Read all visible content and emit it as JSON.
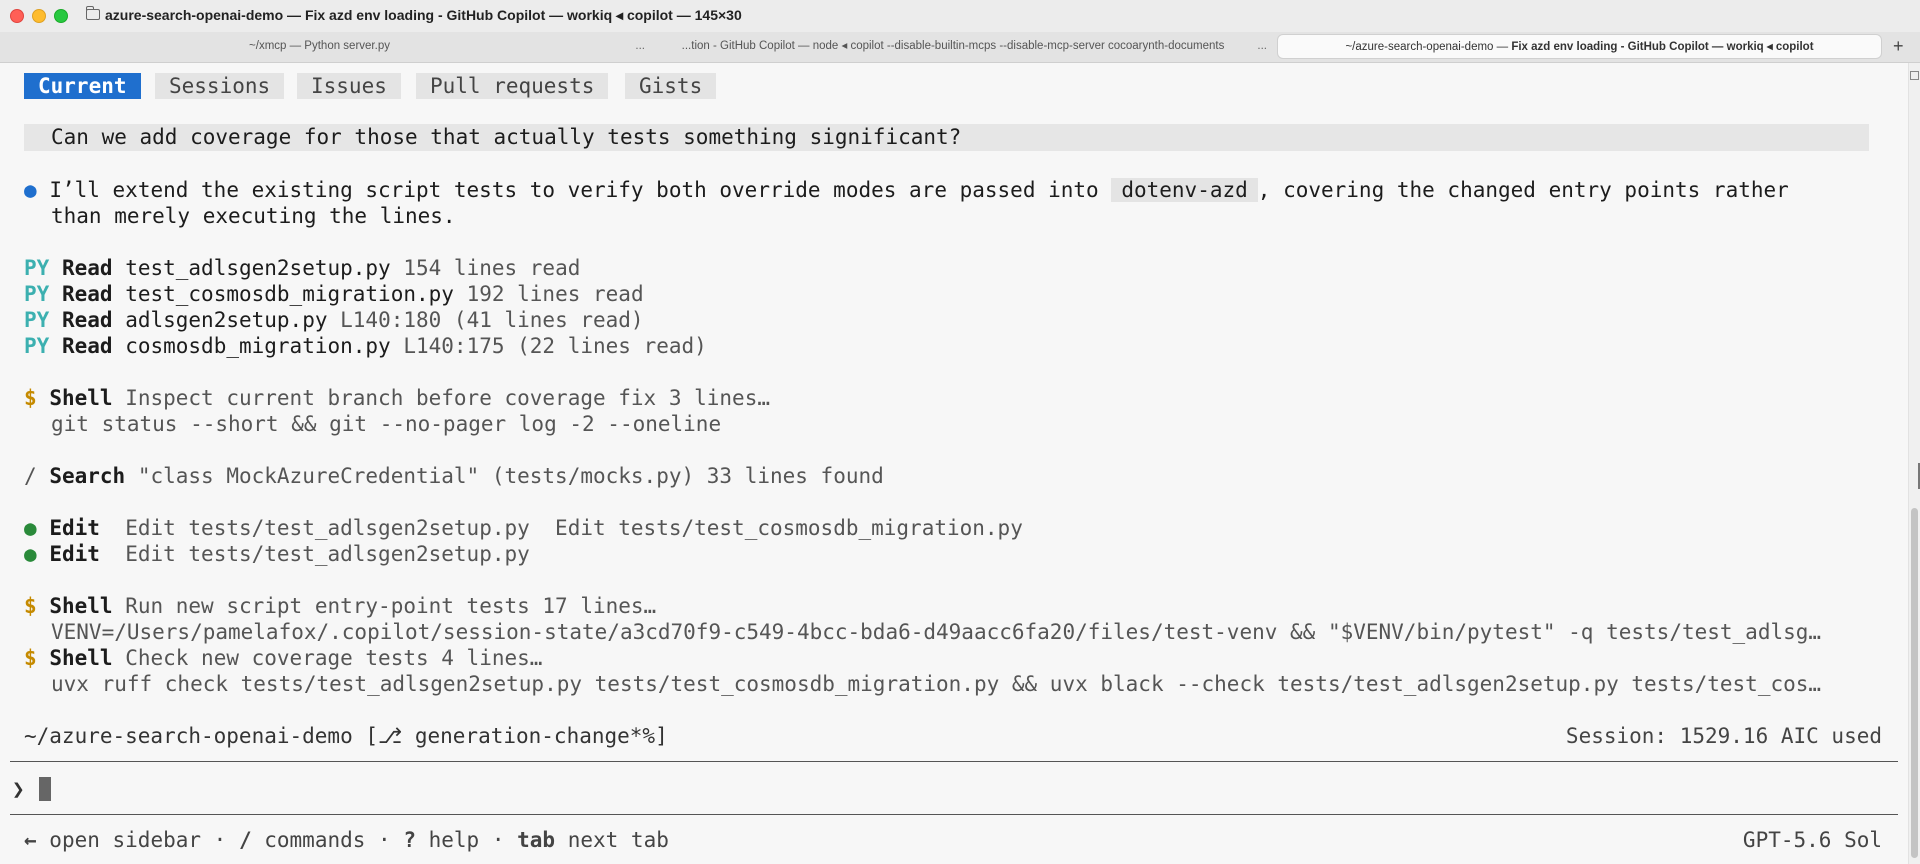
{
  "window": {
    "title": "azure-search-openai-demo — Fix azd env loading - GitHub Copilot — workiq ◂ copilot — 145×30",
    "tabs": [
      {
        "label": "~/xmcp — Python server.py",
        "more": "..."
      },
      {
        "label": "...tion - GitHub Copilot — node ◂ copilot --disable-builtin-mcps --disable-mcp-server cocoarynth-documents",
        "more": "..."
      },
      {
        "label_prefix": "~/azure-search-openai-demo — ",
        "label_bold": "Fix azd env loading - GitHub Copilot — workiq ◂ copilot"
      }
    ],
    "new_tab": "+"
  },
  "app_tabs": [
    {
      "label": "Current",
      "active": true
    },
    {
      "label": "Sessions",
      "active": false
    },
    {
      "label": "Issues",
      "active": false
    },
    {
      "label": "Pull requests",
      "active": false
    },
    {
      "label": "Gists",
      "active": false
    }
  ],
  "conversation": {
    "user_message": "Can we add coverage for those that actually tests something significant?",
    "assistant_bullet": "●",
    "assistant_line1_pre": "I’ll extend the existing script tests to verify both override modes are passed into",
    "assistant_code": "dotenv-azd",
    "assistant_line1_post": ", covering the changed entry points rather",
    "assistant_line2": "than merely executing the lines."
  },
  "reads": [
    {
      "icon": "PY",
      "verb": "Read",
      "file": "test_adlsgen2setup.py",
      "detail": "154 lines read"
    },
    {
      "icon": "PY",
      "verb": "Read",
      "file": "test_cosmosdb_migration.py",
      "detail": "192 lines read"
    },
    {
      "icon": "PY",
      "verb": "Read",
      "file": "adlsgen2setup.py",
      "detail": "L140:180 (41 lines read)"
    },
    {
      "icon": "PY",
      "verb": "Read",
      "file": "cosmosdb_migration.py",
      "detail": "L140:175 (22 lines read)"
    }
  ],
  "shell1": {
    "icon": "$",
    "verb": "Shell",
    "desc": "Inspect current branch before coverage fix 3 lines…",
    "cmd": "git status --short && git --no-pager log -2 --oneline"
  },
  "search": {
    "icon": "/",
    "verb": "Search",
    "desc": "\"class MockAzureCredential\" (tests/mocks.py) 33 lines found"
  },
  "edits": [
    {
      "icon": "●",
      "verb": "Edit",
      "desc": "Edit tests/test_adlsgen2setup.py  Edit tests/test_cosmosdb_migration.py"
    },
    {
      "icon": "●",
      "verb": "Edit",
      "desc": "Edit tests/test_adlsgen2setup.py"
    }
  ],
  "shell2": {
    "icon": "$",
    "verb": "Shell",
    "desc": "Run new script entry-point tests 17 lines…",
    "cmd": "VENV=/Users/pamelafox/.copilot/session-state/a3cd70f9-c549-4bcc-bda6-d49aacc6fa20/files/test-venv && \"$VENV/bin/pytest\" -q tests/test_adlsg…"
  },
  "shell3": {
    "icon": "$",
    "verb": "Shell",
    "desc": "Check new coverage tests 4 lines…",
    "cmd": "uvx ruff check tests/test_adlsgen2setup.py tests/test_cosmosdb_migration.py && uvx black --check tests/test_adlsgen2setup.py tests/test_cos…"
  },
  "status": {
    "cwd": "~/azure-search-openai-demo [⎇ generation-change*%]",
    "session": "Session: 1529.16 AIC used"
  },
  "input": {
    "prompt": "❯",
    "value": ""
  },
  "footer": {
    "hint_left_arrow": "←",
    "hint_open_sidebar": " open sidebar · ",
    "hint_slash": "/",
    "hint_commands": " commands · ",
    "hint_q": "?",
    "hint_help": " help · ",
    "hint_tab": "tab",
    "hint_next_tab": " next tab",
    "model": "GPT-5.6 Sol"
  },
  "colors": {
    "accent": "#1f6fce",
    "py": "#3cb0b0",
    "shell": "#c58a00",
    "edit": "#2a8a3a"
  }
}
